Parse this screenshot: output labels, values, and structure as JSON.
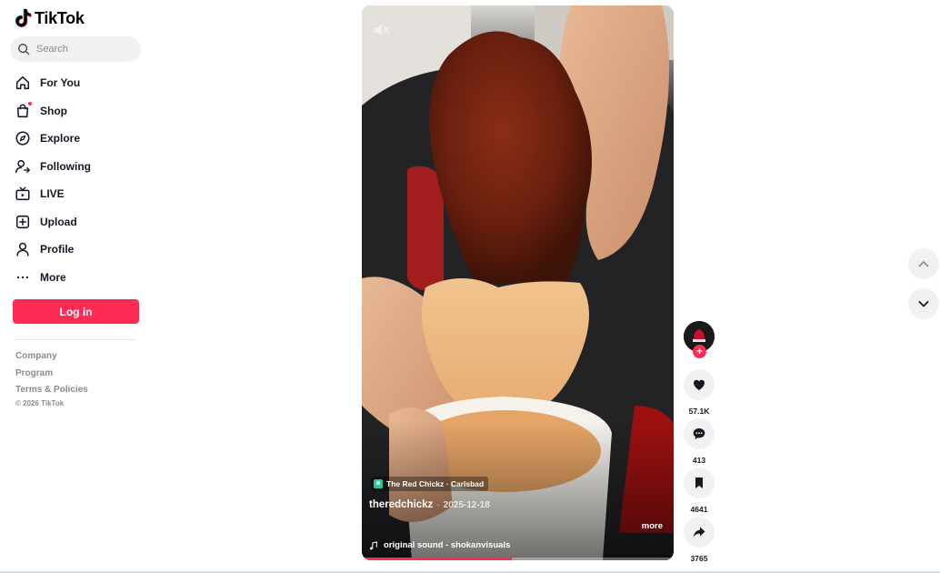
{
  "app": {
    "name": "TikTok",
    "brand_color": "#fe2c55"
  },
  "search": {
    "placeholder": "Search"
  },
  "nav": {
    "items": [
      {
        "label": "For You",
        "icon": "home-icon"
      },
      {
        "label": "Shop",
        "icon": "shopping-bag-icon"
      },
      {
        "label": "Explore",
        "icon": "compass-icon"
      },
      {
        "label": "Following",
        "icon": "following-icon"
      },
      {
        "label": "LIVE",
        "icon": "live-tv-icon"
      },
      {
        "label": "Upload",
        "icon": "plus-square-icon"
      },
      {
        "label": "Profile",
        "icon": "person-icon"
      },
      {
        "label": "More",
        "icon": "more-dots-icon"
      }
    ]
  },
  "auth": {
    "login_label": "Log in"
  },
  "footer": {
    "links": [
      "Company",
      "Program",
      "Terms & Policies"
    ],
    "copyright": "© 2026 TikTok"
  },
  "video": {
    "location": "The Red Chickz · Carlsbad",
    "author": "theredchickz",
    "separator": "·",
    "date": "2025-12-18",
    "more_label": "more",
    "sound": "original sound - shokanvisuals",
    "progress": 0.48
  },
  "actions": {
    "likes": "57.1K",
    "comments": "413",
    "saves": "4641",
    "shares": "3765"
  }
}
